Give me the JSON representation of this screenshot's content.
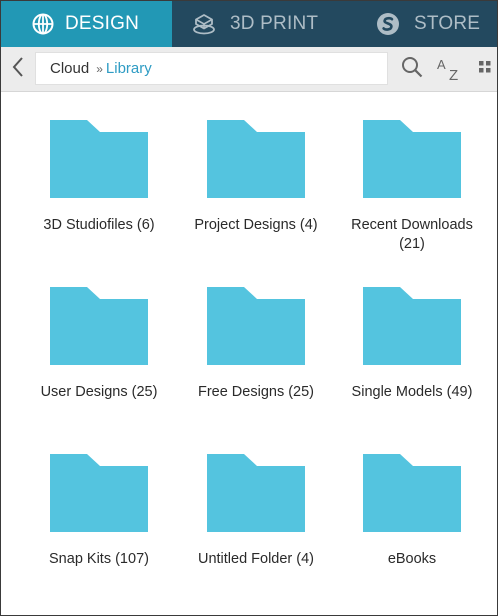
{
  "tabs": [
    {
      "label": "DESIGN",
      "icon": "globe-grid-icon",
      "active": true
    },
    {
      "label": "3D PRINT",
      "icon": "print-cube-icon",
      "active": false
    },
    {
      "label": "STORE",
      "icon": "store-s-icon",
      "active": false
    }
  ],
  "breadcrumb": {
    "root": "Cloud",
    "separator": "»",
    "current": "Library"
  },
  "toolbar": {
    "back_icon": "chevron-left-icon",
    "search_icon": "search-icon",
    "sort_icon": "sort-az-icon",
    "sort_text": "AZ",
    "view_icon": "grid-view-icon"
  },
  "folders": [
    {
      "name": "3D Studiofiles (6)"
    },
    {
      "name": "Project Designs (4)"
    },
    {
      "name": "Recent Downloads (21)"
    },
    {
      "name": "User Designs (25)"
    },
    {
      "name": "Free Designs (25)"
    },
    {
      "name": "Single Models (49)"
    },
    {
      "name": "Snap Kits (107)"
    },
    {
      "name": "Untitled Folder (4)"
    },
    {
      "name": "eBooks"
    }
  ],
  "colors": {
    "tab_bar": "#23495f",
    "tab_active": "#2298b5",
    "folder": "#54c4df",
    "link": "#2f9cc4"
  }
}
